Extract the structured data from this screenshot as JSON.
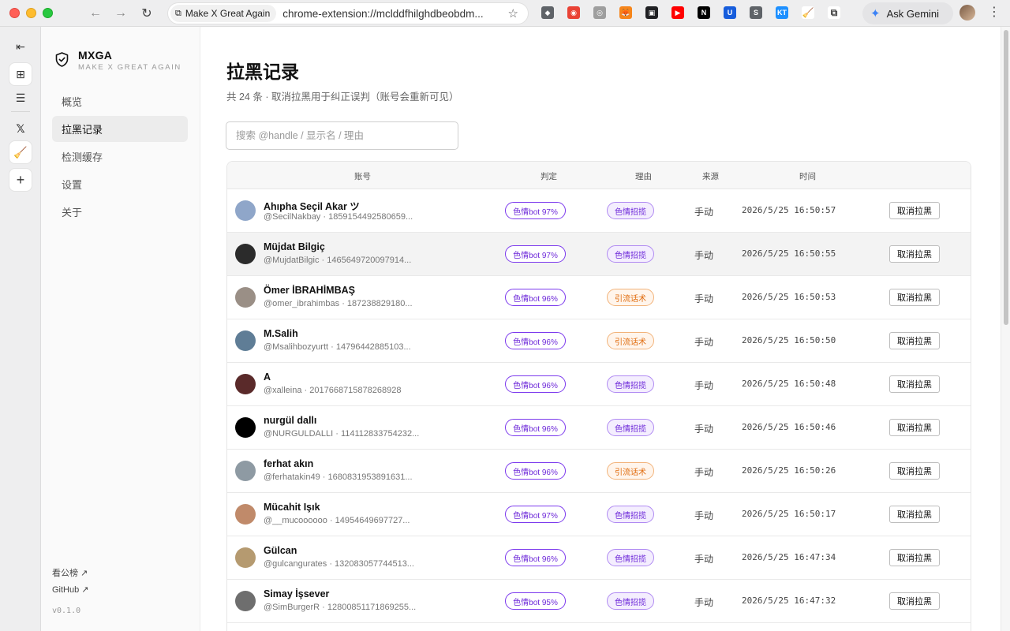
{
  "browser": {
    "tab_title": "Make X Great Again",
    "url": "chrome-extension://mclddfhilghdbeobdm...",
    "ask_gemini": "Ask Gemini",
    "extensions": [
      {
        "name": "shield-ext-icon",
        "color": "#5f6368",
        "glyph": "◆"
      },
      {
        "name": "colorwheel-ext-icon",
        "color": "#e94235",
        "glyph": "◉"
      },
      {
        "name": "circle-ext-icon",
        "color": "#9e9e9e",
        "glyph": "◎"
      },
      {
        "name": "fox-ext-icon",
        "color": "#f6851b",
        "glyph": "🦊"
      },
      {
        "name": "panel-ext-icon",
        "color": "#202124",
        "glyph": "▣"
      },
      {
        "name": "youtube-ext-icon",
        "color": "#ff0000",
        "glyph": "▶"
      },
      {
        "name": "notion-ext-icon",
        "color": "#000000",
        "glyph": "N"
      },
      {
        "name": "bitwarden-ext-icon",
        "color": "#175ddc",
        "glyph": "U"
      },
      {
        "name": "s-ext-icon",
        "color": "#5f6368",
        "glyph": "S"
      },
      {
        "name": "kt-ext-icon",
        "color": "#1e90ff",
        "glyph": "KT"
      },
      {
        "name": "mxga-ext-icon",
        "color": "#ffffff",
        "glyph": "🧹"
      },
      {
        "name": "puzzle-ext-icon",
        "color": "#ffffff",
        "glyph": "⧉"
      }
    ]
  },
  "sidebar": {
    "brand": "MXGA",
    "tagline": "MAKE X GREAT AGAIN",
    "nav": [
      {
        "label": "概览"
      },
      {
        "label": "拉黑记录",
        "active": true
      },
      {
        "label": "检测缓存"
      },
      {
        "label": "设置"
      },
      {
        "label": "关于"
      }
    ],
    "leaderboard_link": "看公榜 ↗",
    "github_link": "GitHub ↗",
    "version": "v0.1.0"
  },
  "main": {
    "title": "拉黑记录",
    "subtitle": "共 24 条 · 取消拉黑用于纠正误判（账号会重新可见）",
    "search_placeholder": "搜索 @handle / 显示名 / 理由"
  },
  "table": {
    "columns": {
      "account": "账号",
      "verdict": "判定",
      "reason": "理由",
      "source": "来源",
      "time": "时间"
    },
    "unblock_label": "取消拉黑",
    "rows": [
      {
        "name": "Ahıpha Seçil Akar ツ",
        "handle": "@SecilNakbay · 1859154492580659...",
        "verdict": "色情bot 97%",
        "reason": "色情招揽",
        "reason_type": "purple",
        "source": "手动",
        "time": "2026/5/25 16:50:57",
        "avatar": "#8fa6c9"
      },
      {
        "name": "Müjdat Bilgiç",
        "handle": "@MujdatBilgic · 1465649720097914...",
        "verdict": "色情bot 97%",
        "reason": "色情招揽",
        "reason_type": "purple",
        "source": "手动",
        "time": "2026/5/25 16:50:55",
        "avatar": "#2b2b2b",
        "hover": true
      },
      {
        "name": "Ömer İBRAHİMBAŞ",
        "handle": "@omer_ibrahimbas · 187238829180...",
        "verdict": "色情bot 96%",
        "reason": "引流话术",
        "reason_type": "orange",
        "source": "手动",
        "time": "2026/5/25 16:50:53",
        "avatar": "#9a8f86"
      },
      {
        "name": "M.Salih",
        "handle": "@Msalihbozyurtt · 14796442885103...",
        "verdict": "色情bot 96%",
        "reason": "引流话术",
        "reason_type": "orange",
        "source": "手动",
        "time": "2026/5/25 16:50:50",
        "avatar": "#5f7d96"
      },
      {
        "name": "A",
        "handle": "@xalleina · 2017668715878268928",
        "verdict": "色情bot 96%",
        "reason": "色情招揽",
        "reason_type": "purple",
        "source": "手动",
        "time": "2026/5/25 16:50:48",
        "avatar": "#5a2a2a"
      },
      {
        "name": "nurgül dallı",
        "handle": "@NURGULDALLI · 114112833754232...",
        "verdict": "色情bot 96%",
        "reason": "色情招揽",
        "reason_type": "purple",
        "source": "手动",
        "time": "2026/5/25 16:50:46",
        "avatar": "#000000"
      },
      {
        "name": "ferhat akın",
        "handle": "@ferhatakin49 · 1680831953891631...",
        "verdict": "色情bot 96%",
        "reason": "引流话术",
        "reason_type": "orange",
        "source": "手动",
        "time": "2026/5/25 16:50:26",
        "avatar": "#8e9aa3"
      },
      {
        "name": "Mücahit Işık",
        "handle": "@__mucoooooo · 14954649697727...",
        "verdict": "色情bot 97%",
        "reason": "色情招揽",
        "reason_type": "purple",
        "source": "手动",
        "time": "2026/5/25 16:50:17",
        "avatar": "#c08a6a"
      },
      {
        "name": "Gülcan",
        "handle": "@gulcangurates · 132083057744513...",
        "verdict": "色情bot 96%",
        "reason": "色情招揽",
        "reason_type": "purple",
        "source": "手动",
        "time": "2026/5/25 16:47:34",
        "avatar": "#b59a70"
      },
      {
        "name": "Simay İşsever",
        "handle": "@SimBurgerR · 12800851171869255...",
        "verdict": "色情bot 95%",
        "reason": "色情招揽",
        "reason_type": "purple",
        "source": "手动",
        "time": "2026/5/25 16:47:32",
        "avatar": "#6e6e6e"
      }
    ]
  }
}
